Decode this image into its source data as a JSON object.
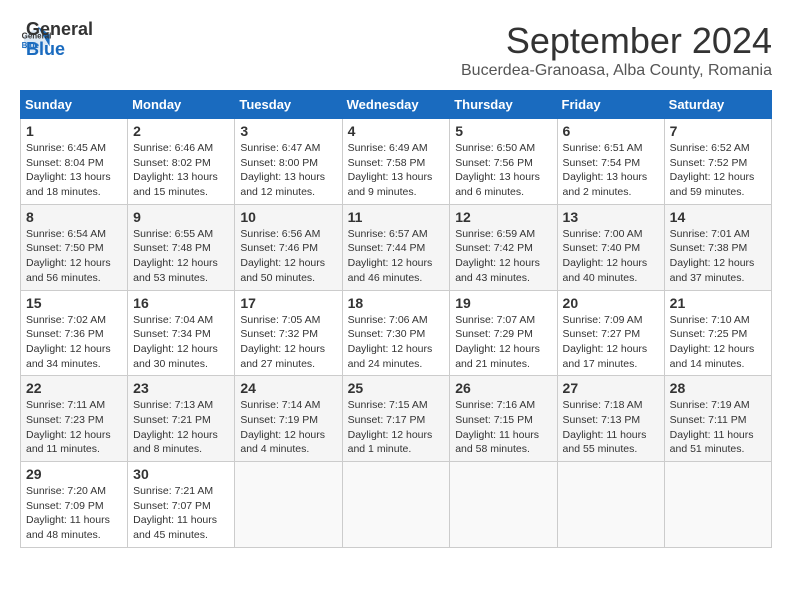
{
  "header": {
    "logo": {
      "general": "General",
      "blue": "Blue"
    },
    "title": "September 2024",
    "location": "Bucerdea-Granoasa, Alba County, Romania"
  },
  "weekdays": [
    "Sunday",
    "Monday",
    "Tuesday",
    "Wednesday",
    "Thursday",
    "Friday",
    "Saturday"
  ],
  "weeks": [
    [
      {
        "day": "1",
        "info": "Sunrise: 6:45 AM\nSunset: 8:04 PM\nDaylight: 13 hours and 18 minutes."
      },
      {
        "day": "2",
        "info": "Sunrise: 6:46 AM\nSunset: 8:02 PM\nDaylight: 13 hours and 15 minutes."
      },
      {
        "day": "3",
        "info": "Sunrise: 6:47 AM\nSunset: 8:00 PM\nDaylight: 13 hours and 12 minutes."
      },
      {
        "day": "4",
        "info": "Sunrise: 6:49 AM\nSunset: 7:58 PM\nDaylight: 13 hours and 9 minutes."
      },
      {
        "day": "5",
        "info": "Sunrise: 6:50 AM\nSunset: 7:56 PM\nDaylight: 13 hours and 6 minutes."
      },
      {
        "day": "6",
        "info": "Sunrise: 6:51 AM\nSunset: 7:54 PM\nDaylight: 13 hours and 2 minutes."
      },
      {
        "day": "7",
        "info": "Sunrise: 6:52 AM\nSunset: 7:52 PM\nDaylight: 12 hours and 59 minutes."
      }
    ],
    [
      {
        "day": "8",
        "info": "Sunrise: 6:54 AM\nSunset: 7:50 PM\nDaylight: 12 hours and 56 minutes."
      },
      {
        "day": "9",
        "info": "Sunrise: 6:55 AM\nSunset: 7:48 PM\nDaylight: 12 hours and 53 minutes."
      },
      {
        "day": "10",
        "info": "Sunrise: 6:56 AM\nSunset: 7:46 PM\nDaylight: 12 hours and 50 minutes."
      },
      {
        "day": "11",
        "info": "Sunrise: 6:57 AM\nSunset: 7:44 PM\nDaylight: 12 hours and 46 minutes."
      },
      {
        "day": "12",
        "info": "Sunrise: 6:59 AM\nSunset: 7:42 PM\nDaylight: 12 hours and 43 minutes."
      },
      {
        "day": "13",
        "info": "Sunrise: 7:00 AM\nSunset: 7:40 PM\nDaylight: 12 hours and 40 minutes."
      },
      {
        "day": "14",
        "info": "Sunrise: 7:01 AM\nSunset: 7:38 PM\nDaylight: 12 hours and 37 minutes."
      }
    ],
    [
      {
        "day": "15",
        "info": "Sunrise: 7:02 AM\nSunset: 7:36 PM\nDaylight: 12 hours and 34 minutes."
      },
      {
        "day": "16",
        "info": "Sunrise: 7:04 AM\nSunset: 7:34 PM\nDaylight: 12 hours and 30 minutes."
      },
      {
        "day": "17",
        "info": "Sunrise: 7:05 AM\nSunset: 7:32 PM\nDaylight: 12 hours and 27 minutes."
      },
      {
        "day": "18",
        "info": "Sunrise: 7:06 AM\nSunset: 7:30 PM\nDaylight: 12 hours and 24 minutes."
      },
      {
        "day": "19",
        "info": "Sunrise: 7:07 AM\nSunset: 7:29 PM\nDaylight: 12 hours and 21 minutes."
      },
      {
        "day": "20",
        "info": "Sunrise: 7:09 AM\nSunset: 7:27 PM\nDaylight: 12 hours and 17 minutes."
      },
      {
        "day": "21",
        "info": "Sunrise: 7:10 AM\nSunset: 7:25 PM\nDaylight: 12 hours and 14 minutes."
      }
    ],
    [
      {
        "day": "22",
        "info": "Sunrise: 7:11 AM\nSunset: 7:23 PM\nDaylight: 12 hours and 11 minutes."
      },
      {
        "day": "23",
        "info": "Sunrise: 7:13 AM\nSunset: 7:21 PM\nDaylight: 12 hours and 8 minutes."
      },
      {
        "day": "24",
        "info": "Sunrise: 7:14 AM\nSunset: 7:19 PM\nDaylight: 12 hours and 4 minutes."
      },
      {
        "day": "25",
        "info": "Sunrise: 7:15 AM\nSunset: 7:17 PM\nDaylight: 12 hours and 1 minute."
      },
      {
        "day": "26",
        "info": "Sunrise: 7:16 AM\nSunset: 7:15 PM\nDaylight: 11 hours and 58 minutes."
      },
      {
        "day": "27",
        "info": "Sunrise: 7:18 AM\nSunset: 7:13 PM\nDaylight: 11 hours and 55 minutes."
      },
      {
        "day": "28",
        "info": "Sunrise: 7:19 AM\nSunset: 7:11 PM\nDaylight: 11 hours and 51 minutes."
      }
    ],
    [
      {
        "day": "29",
        "info": "Sunrise: 7:20 AM\nSunset: 7:09 PM\nDaylight: 11 hours and 48 minutes."
      },
      {
        "day": "30",
        "info": "Sunrise: 7:21 AM\nSunset: 7:07 PM\nDaylight: 11 hours and 45 minutes."
      },
      null,
      null,
      null,
      null,
      null
    ]
  ]
}
